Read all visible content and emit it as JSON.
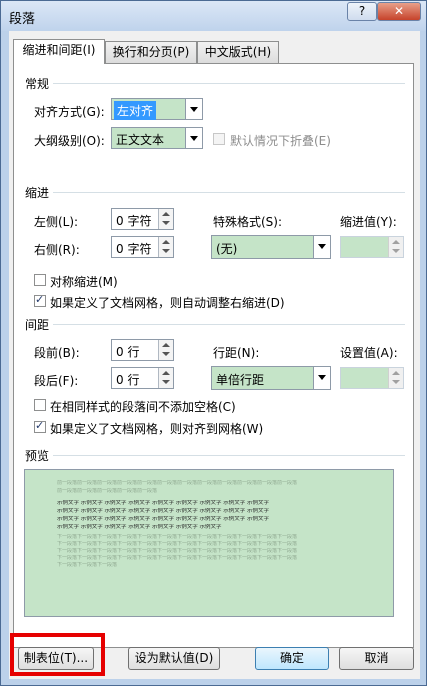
{
  "window": {
    "title": "段落",
    "help_label": "?",
    "close_label": "✕"
  },
  "tabs": [
    {
      "label": "缩进和间距(I)",
      "active": true
    },
    {
      "label": "换行和分页(P)",
      "active": false
    },
    {
      "label": "中文版式(H)",
      "active": false
    }
  ],
  "general": {
    "section_label": "常规",
    "alignment_label": "对齐方式(G):",
    "alignment_value": "左对齐",
    "outline_label": "大纲级别(O):",
    "outline_value": "正文文本",
    "collapse_label": "默认情况下折叠(E)"
  },
  "indent": {
    "section_label": "缩进",
    "left_label": "左侧(L):",
    "left_value": "0 字符",
    "right_label": "右侧(R):",
    "right_value": "0 字符",
    "special_label": "特殊格式(S):",
    "special_value": "(无)",
    "indent_by_label": "缩进值(Y):",
    "mirror_label": "对称缩进(M)",
    "auto_adjust_label": "如果定义了文档网格，则自动调整右缩进(D)"
  },
  "spacing": {
    "section_label": "间距",
    "before_label": "段前(B):",
    "before_value": "0 行",
    "after_label": "段后(F):",
    "after_value": "0 行",
    "line_spacing_label": "行距(N):",
    "line_spacing_value": "单倍行距",
    "at_label": "设置值(A):",
    "no_space_label": "在相同样式的段落间不添加空格(C)",
    "snap_grid_label": "如果定义了文档网格，则对齐到网格(W)"
  },
  "preview": {
    "section_label": "预览",
    "prev_line1": "前一段落前一段落前一段落前一段落前一段落前一段落前一段落前一段落前一段落前一段落前一段落前一段落",
    "prev_line2": "前一段落前一段落前一段落前一段落前一段落",
    "sample_line": "示例文字 示例文字 示例文字 示例文字 示例文字 示例文字 示例文字 示例文字 示例文字",
    "sample_last": "示例文字 示例文字 示例文字 示例文字 示例文字 示例文字 示例文字",
    "next_line": "下一段落下一段落下一段落下一段落下一段落下一段落下一段落下一段落下一段落下一段落下一段落下一段落",
    "next_last": "下一段落下一段落下一段落"
  },
  "buttons": {
    "tabs_label": "制表位(T)...",
    "set_default_label": "设为默认值(D)",
    "ok_label": "确定",
    "cancel_label": "取消"
  },
  "colors": {
    "field_green": "#c5e4c8",
    "selection_blue": "#3399ff",
    "highlight_red": "#e60000"
  }
}
